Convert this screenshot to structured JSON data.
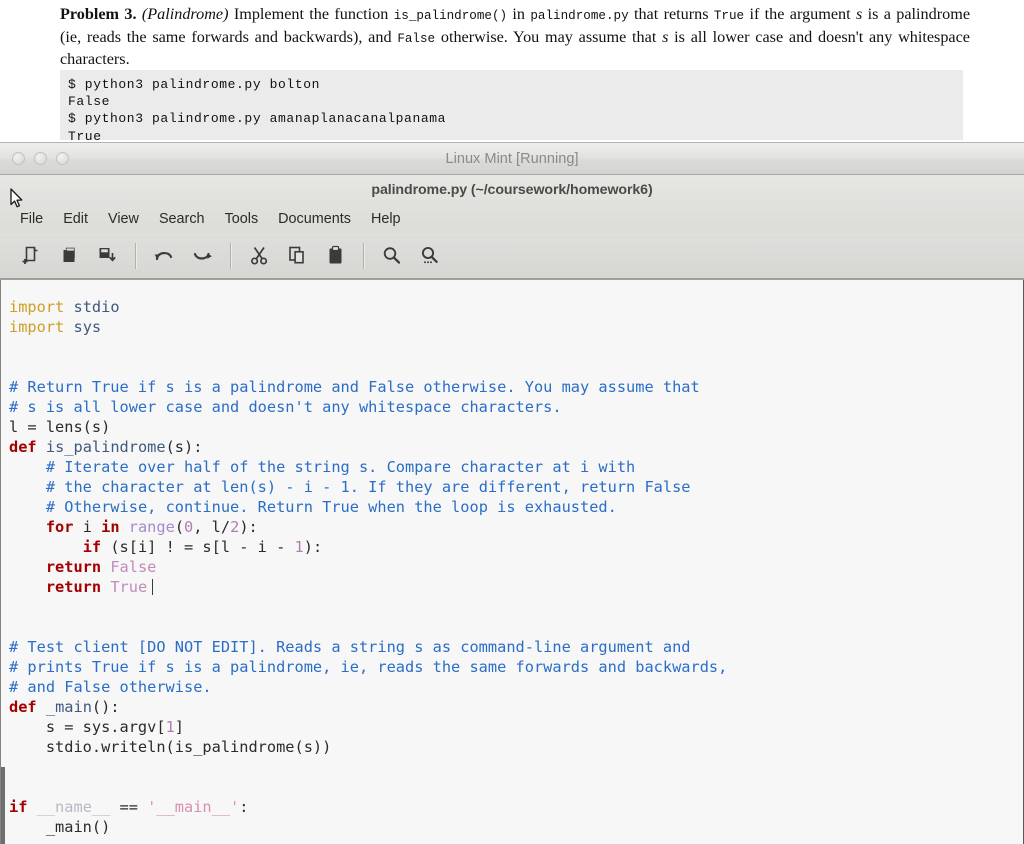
{
  "document": {
    "problem_label": "Problem 3.",
    "problem_topic": "(Palindrome)",
    "text_1": " Implement the function ",
    "code_1": "is_palindrome()",
    "text_2": " in ",
    "code_2": "palindrome.py",
    "text_3": " that returns ",
    "code_3": "True",
    "text_4": " if the argument ",
    "italic_1": "s",
    "text_5": " is a palindrome (ie, reads the same forwards and backwards), and ",
    "code_4": "False",
    "text_6": " otherwise. You may assume that ",
    "italic_2": "s",
    "text_7": " is all lower case and doesn't any whitespace characters.",
    "terminal_block": "$ python3 palindrome.py bolton\nFalse\n$ python3 palindrome.py amanaplanacanalpanama\nTrue"
  },
  "vm": {
    "title": "Linux Mint [Running]",
    "traffic_lights": [
      "close",
      "minimize",
      "maximize"
    ]
  },
  "app": {
    "title": "palindrome.py (~/coursework/homework6)",
    "menu": [
      {
        "label": "File"
      },
      {
        "label": "Edit"
      },
      {
        "label": "View"
      },
      {
        "label": "Search"
      },
      {
        "label": "Tools"
      },
      {
        "label": "Documents"
      },
      {
        "label": "Help"
      }
    ],
    "toolbar": [
      {
        "name": "new-document-icon",
        "tooltip": "New"
      },
      {
        "name": "open-document-icon",
        "tooltip": "Open"
      },
      {
        "name": "save-document-icon",
        "tooltip": "Save"
      },
      {
        "name": "undo-icon",
        "tooltip": "Undo"
      },
      {
        "name": "redo-icon",
        "tooltip": "Redo"
      },
      {
        "name": "cut-icon",
        "tooltip": "Cut"
      },
      {
        "name": "copy-icon",
        "tooltip": "Copy"
      },
      {
        "name": "paste-icon",
        "tooltip": "Paste"
      },
      {
        "name": "find-icon",
        "tooltip": "Find"
      },
      {
        "name": "find-replace-icon",
        "tooltip": "Find and Replace"
      }
    ]
  },
  "editor": {
    "filename": "palindrome.py",
    "lines": [
      "import stdio",
      "import sys",
      "",
      "",
      "# Return True if s is a palindrome and False otherwise. You may assume that",
      "# s is all lower case and doesn't any whitespace characters.",
      "l = lens(s)",
      "def is_palindrome(s):",
      "    # Iterate over half of the string s. Compare character at i with",
      "    # the character at len(s) - i - 1. If they are different, return False",
      "    # Otherwise, continue. Return True when the loop is exhausted.",
      "    for i in range(0, l/2):",
      "        if (s[i] ! = s[l - i - 1):",
      "    return False",
      "    return True",
      "",
      "",
      "# Test client [DO NOT EDIT]. Reads a string s as command-line argument and",
      "# prints True if s is a palindrome, ie, reads the same forwards and backwards,",
      "# and False otherwise.",
      "def _main():",
      "    s = sys.argv[1]",
      "    stdio.writeln(is_palindrome(s))",
      "",
      "",
      "if __name__ == '__main__':",
      "    _main()"
    ]
  },
  "colors": {
    "keyword": "#a40000",
    "import": "#ce9e26",
    "comment": "#2a6ec7",
    "builtin": "#a88ad0",
    "number": "#b07fb0",
    "constant": "#c08cb8",
    "string": "#d98fb0",
    "editor_background": "#f7f7f7",
    "chrome_background": "#d6d6d3",
    "vm_title_text": "#8a8a8a"
  }
}
